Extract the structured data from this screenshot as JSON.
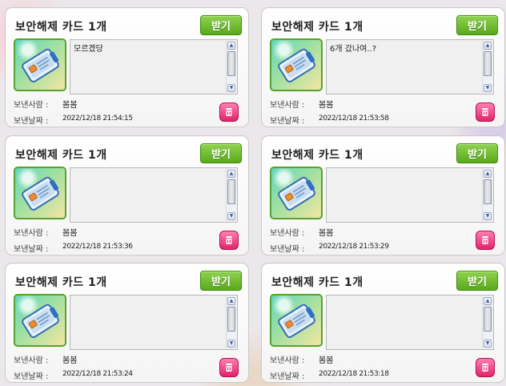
{
  "cards": [
    {
      "title": "보안해제 카드 1개",
      "receive_label": "받기",
      "message": "모르겠당",
      "sender_label": "보낸사람 :",
      "sender": "봄봄",
      "date_label": "보낸날짜 :",
      "date": "2022/12/18 21:54:15"
    },
    {
      "title": "보안해제 카드 1개",
      "receive_label": "받기",
      "message": "6개 갔나여..?",
      "sender_label": "보낸사람 :",
      "sender": "봄봄",
      "date_label": "보낸날짜 :",
      "date": "2022/12/18 21:53:58"
    },
    {
      "title": "보안해제 카드 1개",
      "receive_label": "받기",
      "message": "",
      "sender_label": "보낸사람 :",
      "sender": "봄봄",
      "date_label": "보낸날짜 :",
      "date": "2022/12/18 21:53:36"
    },
    {
      "title": "보안해제 카드 1개",
      "receive_label": "받기",
      "message": "",
      "sender_label": "보낸사람 :",
      "sender": "봄봄",
      "date_label": "보낸날짜 :",
      "date": "2022/12/18 21:53:29"
    },
    {
      "title": "보안해제 카드 1개",
      "receive_label": "받기",
      "message": "",
      "sender_label": "보낸사람 :",
      "sender": "봄봄",
      "date_label": "보낸날짜 :",
      "date": "2022/12/18 21:53:24"
    },
    {
      "title": "보안해제 카드 1개",
      "receive_label": "받기",
      "message": "",
      "sender_label": "보낸사람 :",
      "sender": "봄봄",
      "date_label": "보낸날짜 :",
      "date": "2022/12/18 21:53:18"
    }
  ],
  "icons": {
    "item": "security-card-icon",
    "delete": "trash-icon",
    "scroll_up": "arrow-up-icon",
    "scroll_down": "arrow-down-icon"
  },
  "colors": {
    "receive_button": "#6bb826",
    "item_frame": "#58a12e",
    "delete_button": "#e2226c"
  }
}
